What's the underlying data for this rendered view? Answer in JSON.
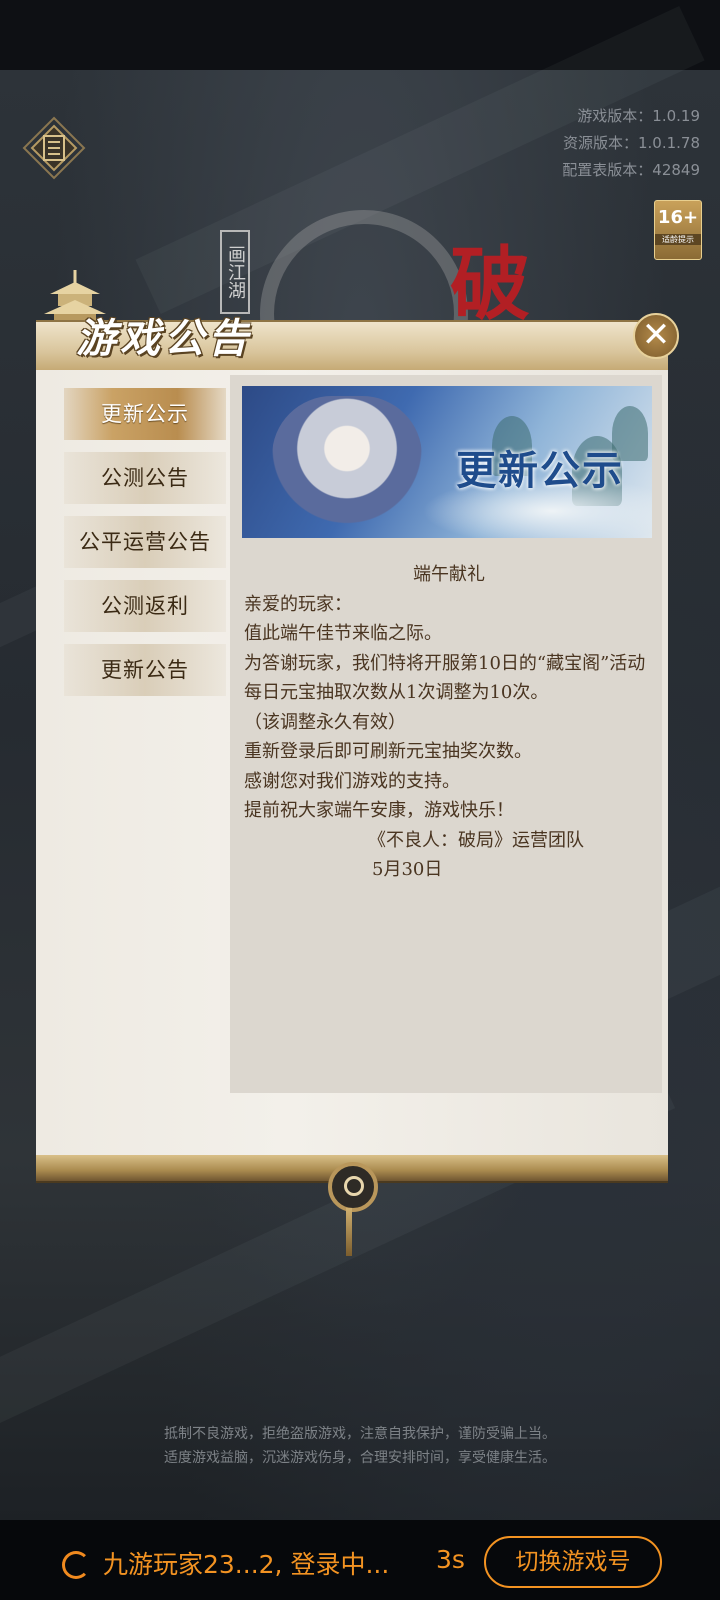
{
  "version_info": {
    "game_version": "游戏版本：1.0.19",
    "resource_version": "资源版本：1.0.1.78",
    "config_version": "配置表版本：42849"
  },
  "age_badge": {
    "rating": "16+",
    "tip": "适龄提示"
  },
  "logo": {
    "seal_text": "画江湖",
    "title_char": "破"
  },
  "panel": {
    "title": "游戏公告",
    "close_label": "✕",
    "tabs": [
      {
        "label": "更新公示",
        "active": true
      },
      {
        "label": "公测公告",
        "active": false
      },
      {
        "label": "公平运营公告",
        "active": false
      },
      {
        "label": "公测返利",
        "active": false
      },
      {
        "label": "更新公告",
        "active": false
      }
    ],
    "banner_title": "更新公示",
    "notice": {
      "heading": "端午献礼",
      "greeting": "亲爱的玩家：",
      "line1": "值此端午佳节来临之际。",
      "line2": "为答谢玩家，我们特将开服第10日的“藏宝阁”活动每日元宝抽取次数从1次调整为10次。",
      "line3": "（该调整永久有效）",
      "line4": "重新登录后即可刷新元宝抽奖次数。",
      "line5": "感谢您对我们游戏的支持。",
      "line6": "提前祝大家端午安康，游戏快乐！",
      "signature": "《不良人：破局》运营团队",
      "date": "5月30日"
    }
  },
  "health_warning": {
    "line1": "抵制不良游戏，拒绝盗版游戏，注意自我保护，谨防受骗上当。",
    "line2": "适度游戏益脑，沉迷游戏伤身，合理安排时间，享受健康生活。"
  },
  "login_bar": {
    "status": "九游玩家23...2, 登录中...",
    "countdown": "3s",
    "switch_button": "切换游戏号"
  },
  "colors": {
    "accent": "#f39322",
    "panel_gold": "#b98d4f",
    "banner_text": "#1f4c8c"
  },
  "icons": [
    "menu-icon",
    "close-icon",
    "loading-spinner-icon",
    "pagoda-icon",
    "medallion-icon"
  ]
}
